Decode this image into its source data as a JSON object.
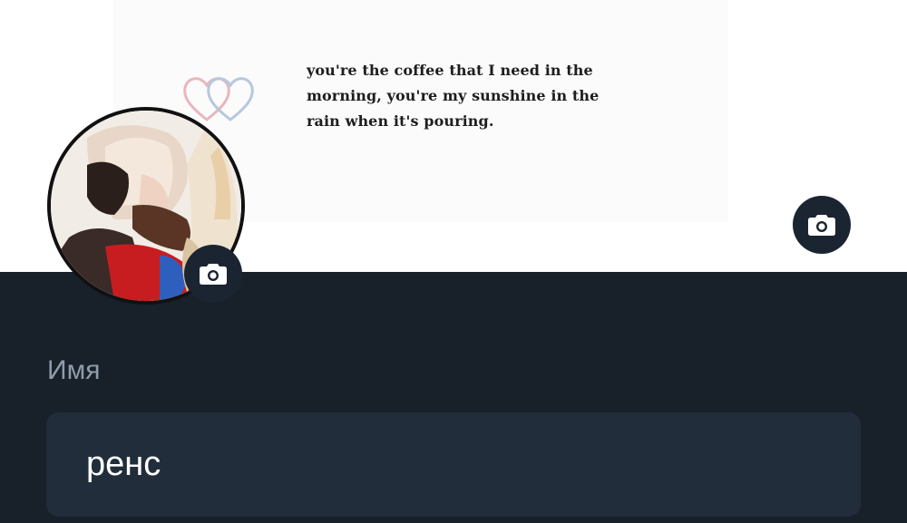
{
  "profile": {
    "banner": {
      "quote_lines": [
        "you're the coffee that I need in the",
        "morning, you're my sunshine in the",
        "rain when it's pouring."
      ],
      "decoration_icon": "double-hearts-icon",
      "camera_icon": "camera-icon"
    },
    "avatar": {
      "camera_icon": "camera-icon"
    },
    "name_field": {
      "label": "Имя",
      "value": "ренс"
    }
  },
  "colors": {
    "background": "#18202a",
    "field_background": "#222d3b",
    "label": "#8f9caa",
    "camera_button": "#1b2431"
  }
}
